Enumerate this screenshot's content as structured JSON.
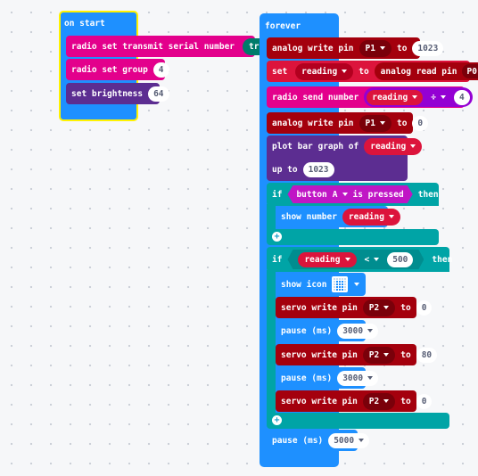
{
  "on_start": {
    "hat": "on start",
    "radio_serial": {
      "label": "radio set transmit serial number",
      "value": "true"
    },
    "radio_group": {
      "label": "radio set group",
      "value": "4"
    },
    "brightness": {
      "label": "set brightness",
      "value": "64"
    }
  },
  "forever": {
    "hat": "forever",
    "analog_write_1": {
      "label": "analog write pin",
      "pin": "P1",
      "to": "to",
      "value": "1023"
    },
    "set_reading": {
      "label": "set",
      "var": "reading",
      "to": "to",
      "reporter": "analog read pin",
      "pin": "P0"
    },
    "radio_send": {
      "label": "radio send number",
      "var": "reading",
      "op": "÷",
      "value": "4"
    },
    "analog_write_2": {
      "label": "analog write pin",
      "pin": "P1",
      "to": "to",
      "value": "0"
    },
    "plot": {
      "label": "plot bar graph of",
      "var": "reading",
      "upto_label": "up to",
      "upto_value": "1023"
    },
    "if1": {
      "if_label": "if",
      "button_label": "button",
      "button": "A",
      "pressed": "is pressed",
      "then": "then",
      "show_number": {
        "label": "show number",
        "var": "reading"
      }
    },
    "if2": {
      "if_label": "if",
      "var": "reading",
      "op": "<",
      "value": "500",
      "then": "then",
      "show_icon": {
        "label": "show icon",
        "icon": "ghost-icon"
      },
      "servo_1": {
        "label": "servo write pin",
        "pin": "P2",
        "to": "to",
        "value": "0"
      },
      "pause_1": {
        "label": "pause (ms)",
        "value": "3000"
      },
      "servo_2": {
        "label": "servo write pin",
        "pin": "P2",
        "to": "to",
        "value": "80"
      },
      "pause_2": {
        "label": "pause (ms)",
        "value": "3000"
      },
      "servo_3": {
        "label": "servo write pin",
        "pin": "P2",
        "to": "to",
        "value": "0"
      }
    },
    "pause_end": {
      "label": "pause (ms)",
      "value": "5000"
    }
  },
  "colors": {
    "basic": "#1e90ff",
    "radio": "#e3008c",
    "led": "#5c2d91",
    "pins": "#a4000d",
    "logic": "#00a4a6",
    "variables": "#dc143c",
    "math": "#9400d3",
    "input": "#c016c5",
    "selected_outline": "#fff200"
  }
}
